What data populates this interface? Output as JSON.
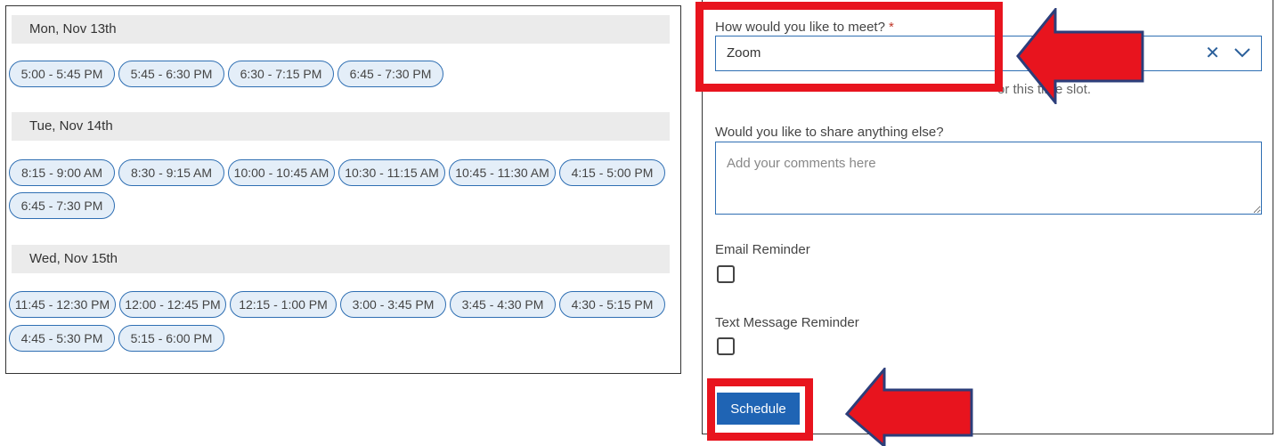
{
  "days": [
    {
      "label": "Mon, Nov 13th",
      "rows": [
        [
          "5:00 - 5:45 PM",
          "5:45 - 6:30 PM",
          "6:30 - 7:15 PM",
          "6:45 - 7:30 PM"
        ]
      ]
    },
    {
      "label": "Tue, Nov 14th",
      "rows": [
        [
          "8:15 - 9:00 AM",
          "8:30 - 9:15 AM",
          "10:00 - 10:45 AM",
          "10:30 - 11:15 AM",
          "10:45 - 11:30 AM",
          "4:15 - 5:00 PM"
        ],
        [
          "6:45 - 7:30 PM"
        ]
      ]
    },
    {
      "label": "Wed, Nov 15th",
      "rows": [
        [
          "11:45 - 12:30 PM",
          "12:00 - 12:45 PM",
          "12:15 - 1:00 PM",
          "3:00 - 3:45 PM",
          "3:45 - 4:30 PM",
          "4:30 - 5:15 PM"
        ],
        [
          "4:45 - 5:30 PM",
          "5:15 - 6:00 PM"
        ]
      ]
    }
  ],
  "form": {
    "meet_label": "How would you like to meet?",
    "required_mark": "*",
    "meet_value": "Zoom",
    "clear_icon": "✕",
    "helper_text": "or this time slot.",
    "comments_label": "Would you like to share anything else?",
    "comments_placeholder": "Add your comments here",
    "email_label": "Email Reminder",
    "text_label": "Text Message Reminder",
    "schedule_label": "Schedule"
  },
  "colors": {
    "accent": "#1f64b4",
    "slot_bg": "#e4eef8",
    "annotation": "#e8141e",
    "arrow_outline": "#2c3e7a"
  }
}
